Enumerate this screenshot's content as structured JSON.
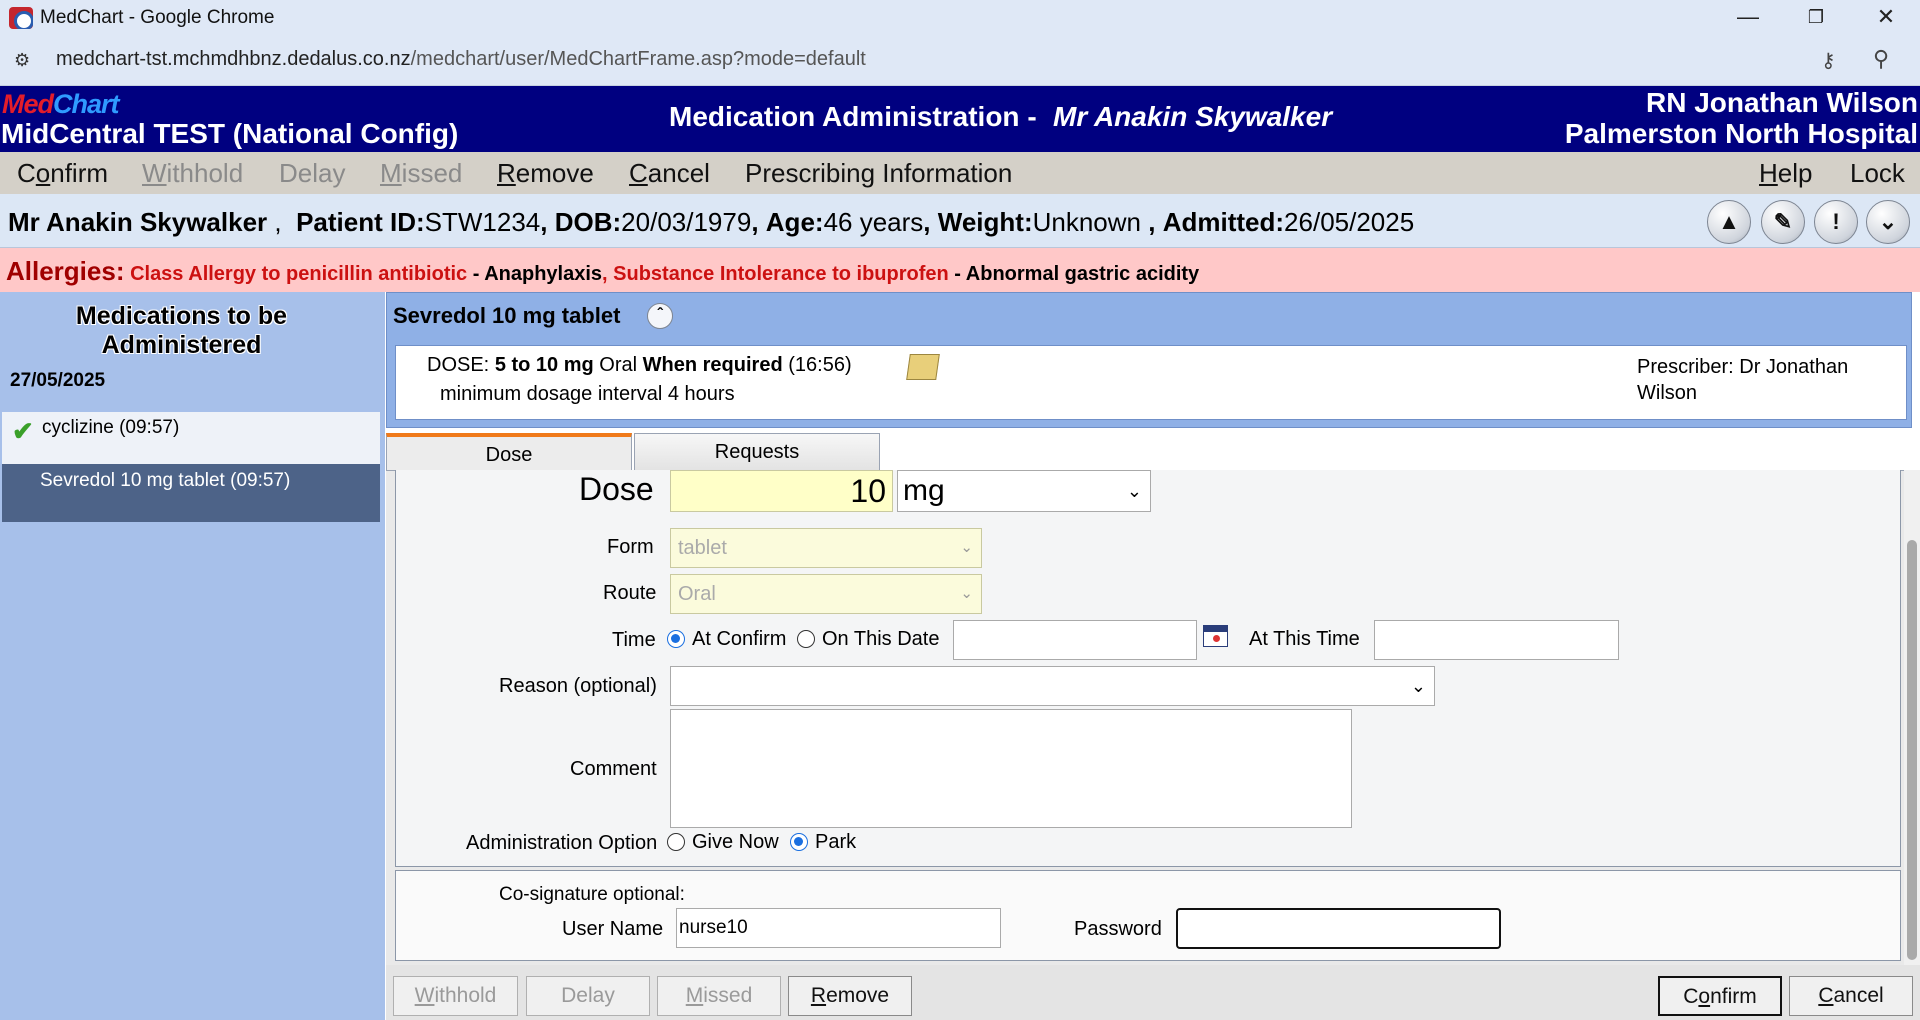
{
  "browser": {
    "window_title": "MedChart - Google Chrome",
    "url_domain": "medchart-tst.mchmdhbnz.dedalus.co.nz",
    "url_path": "/medchart/user/MedChartFrame.asp?mode=default",
    "icons": [
      "minimize-icon",
      "restore-icon",
      "close-icon",
      "site-info-icon",
      "key-icon",
      "zoom-icon"
    ]
  },
  "header": {
    "logo_part1": "Med",
    "logo_part2": "Chart",
    "site": "MidCentral TEST (National Config)",
    "screen_title": "Medication Administration -",
    "patient": "Mr Anakin Skywalker",
    "user": "RN Jonathan Wilson",
    "hospital": "Palmerston North Hospital"
  },
  "menu": {
    "confirm_pre": "C",
    "confirm_ul": "o",
    "confirm_post": "nfirm",
    "withhold_ul": "W",
    "withhold_post": "ithhold",
    "delay": "Delay",
    "missed_ul": "M",
    "missed_post": "issed",
    "remove_ul": "R",
    "remove_post": "emove",
    "cancel_ul": "C",
    "cancel_post": "ancel",
    "prescribing": "Prescribing Information",
    "help_ul": "H",
    "help_post": "elp",
    "lock": "Lock"
  },
  "patient_banner": {
    "name": "Mr Anakin Skywalker",
    "sep": ",",
    "id_label": "Patient ID:",
    "id": "STW1234",
    "dob_label": "DOB:",
    "dob": "20/03/1979",
    "age_label": "Age:",
    "age": "46 years",
    "weight_label": "Weight:",
    "weight": "Unknown",
    "admitted_label": "Admitted:",
    "admitted": "26/05/2025",
    "icons": [
      "bell-icon",
      "edit-note-icon",
      "alert-icon",
      "expand-down-icon"
    ]
  },
  "allergies": {
    "label": "Allergies:",
    "a1": "Class Allergy to penicillin antibiotic",
    "r1": " - Anaphylaxis",
    "a2": ", Substance Intolerance to ibuprofen",
    "r2": " - Abnormal gastric acidity"
  },
  "med_list": {
    "heading": "Medications to be Administered",
    "date": "27/05/2025",
    "items": [
      {
        "label": "cyclizine (09:57)",
        "status": "check-icon"
      },
      {
        "label": "Sevredol 10 mg tablet (09:57)",
        "status": "selected"
      }
    ]
  },
  "order": {
    "title": "Sevredol 10 mg tablet",
    "dose_label": "DOSE:",
    "dose_amount": "5 to 10 mg",
    "route": "Oral",
    "frequency": "When required",
    "time": "(16:56)",
    "interval": "minimum dosage interval 4 hours",
    "prescriber": "Prescriber: Dr Jonathan Wilson"
  },
  "tabs": {
    "dose": "Dose",
    "requests": "Requests"
  },
  "form": {
    "dose_label": "Dose",
    "dose_value": "10",
    "unit": "mg",
    "form_label": "Form",
    "form_value": "tablet",
    "route_label": "Route",
    "route_value": "Oral",
    "time_label": "Time",
    "time_opt1": "At Confirm",
    "time_opt2": "On This Date",
    "selected_time_option": "At Confirm",
    "date_value": "",
    "at_this_time_label": "At This Time",
    "time_value": "",
    "reason_label": "Reason (optional)",
    "reason_value": "",
    "comment_label": "Comment",
    "comment_value": "",
    "admin_option_label": "Administration Option",
    "admin_opt1": "Give Now",
    "admin_opt2": "Park",
    "selected_admin_option": "Park"
  },
  "cosignature": {
    "title": "Co-signature optional:",
    "username_label": "User Name",
    "username": "nurse10",
    "password_label": "Password",
    "password": ""
  },
  "buttons": {
    "withhold_ul": "W",
    "withhold_post": "ithhold",
    "delay": "Delay",
    "missed_ul": "M",
    "missed_post": "issed",
    "remove_ul": "R",
    "remove_post": "emove",
    "confirm_pre": "C",
    "confirm_ul": "o",
    "confirm_post": "nfirm",
    "cancel_ul": "C",
    "cancel_post": "ancel"
  },
  "colors": {
    "header_bg": "#000080",
    "allergy_bg": "#ffc8c8",
    "left_panel_bg": "#a7c0ea",
    "selected_item_bg": "#4d6388",
    "active_tab_accent": "#f07a1a"
  }
}
